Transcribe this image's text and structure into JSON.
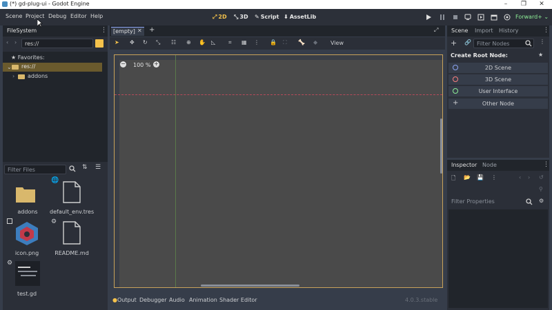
{
  "window": {
    "title": "(*) gd-plug-ui - Godot Engine",
    "controls": [
      "–",
      "❐",
      "✕"
    ]
  },
  "menu": {
    "items": [
      "Scene",
      "Project",
      "Debug",
      "Editor",
      "Help"
    ]
  },
  "workspaces": {
    "items": [
      {
        "label": "2D",
        "icon": "2d-icon",
        "active": true
      },
      {
        "label": "3D",
        "icon": "3d-icon",
        "active": false
      },
      {
        "label": "Script",
        "icon": "script-icon",
        "active": false
      },
      {
        "label": "AssetLib",
        "icon": "assetlib-icon",
        "active": false
      }
    ]
  },
  "renderer": {
    "label": "Forward+"
  },
  "filesystem": {
    "title": "FileSystem",
    "path": "res://",
    "favorites": "Favorites:",
    "tree": [
      {
        "label": "res://"
      },
      {
        "label": "addons"
      }
    ],
    "filter_placeholder": "Filter Files",
    "files": [
      {
        "label": "addons",
        "kind": "folder"
      },
      {
        "label": "default_env.tres",
        "kind": "file"
      },
      {
        "label": "icon.png",
        "kind": "image"
      },
      {
        "label": "README.md",
        "kind": "file"
      },
      {
        "label": "test.gd",
        "kind": "script"
      }
    ]
  },
  "editor": {
    "tab_label": "[empty]",
    "zoom": "100 %",
    "view_label": "View"
  },
  "bottom_bar": {
    "tabs": [
      "Output",
      "Debugger",
      "Audio",
      "Animation",
      "Shader Editor"
    ],
    "version": "4.0.3.stable"
  },
  "scene_dock": {
    "tabs": [
      "Scene",
      "Import",
      "History"
    ],
    "filter_placeholder": "Filter Nodes",
    "create_root_label": "Create Root Node:",
    "options": [
      {
        "label": "2D Scene",
        "color": "#8da5f3"
      },
      {
        "label": "3D Scene",
        "color": "#fc7f7f"
      },
      {
        "label": "User Interface",
        "color": "#8eef97"
      },
      {
        "label": "Other Node",
        "color": "#e0e0e0"
      }
    ]
  },
  "inspector": {
    "tabs": [
      "Inspector",
      "Node"
    ],
    "filter_placeholder": "Filter Properties"
  },
  "colors": {
    "accent": "#f5c24b",
    "panel": "#2b2f38",
    "background": "#363d4a"
  }
}
